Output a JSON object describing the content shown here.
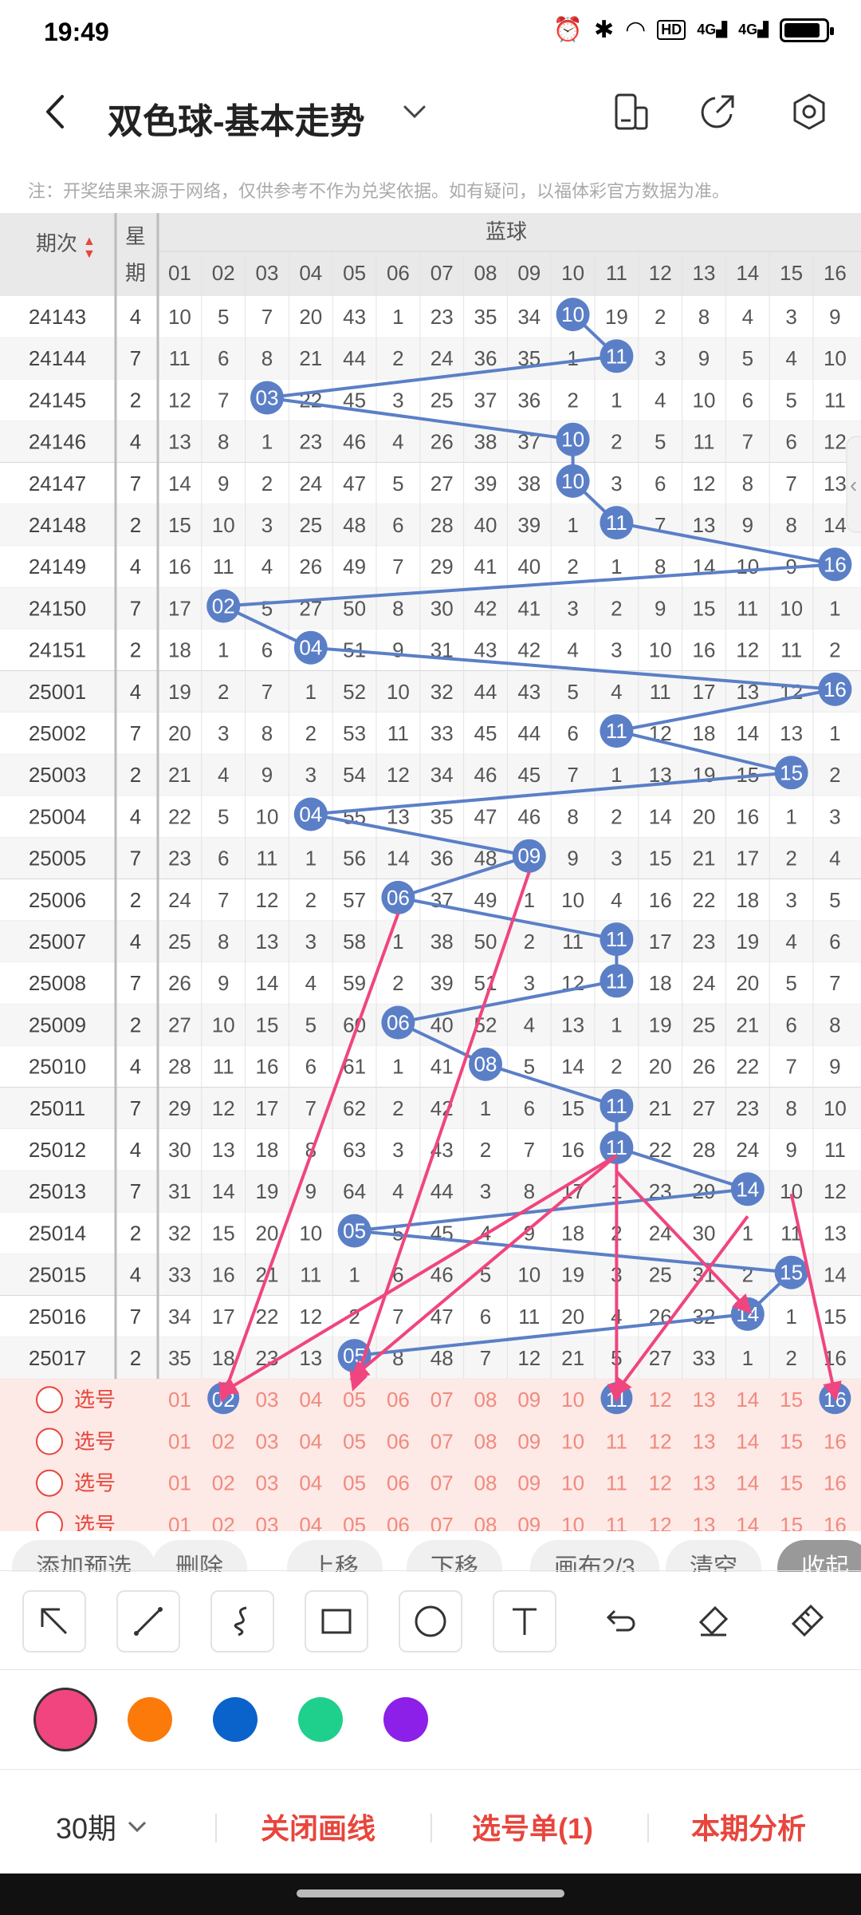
{
  "status": {
    "time": "19:49",
    "hd_label": "HD",
    "net1": "4G",
    "net2": "4G"
  },
  "app_bar": {
    "title": "双色球-基本走势"
  },
  "notice": "注：开奖结果来源于网络，仅供参考不作为兑奖依据。如有疑问，以福体彩官方数据为准。",
  "table": {
    "header_period": "期次",
    "header_weekday_1": "星",
    "header_weekday_2": "期",
    "header_blue": "蓝球",
    "columns": [
      "01",
      "02",
      "03",
      "04",
      "05",
      "06",
      "07",
      "08",
      "09",
      "10",
      "11",
      "12",
      "13",
      "14",
      "15",
      "16"
    ],
    "rows": [
      {
        "period": "24143",
        "weekday": "4",
        "blue": "10",
        "cells": [
          "10",
          "5",
          "7",
          "20",
          "43",
          "1",
          "23",
          "35",
          "34",
          "10",
          "19",
          "2",
          "8",
          "4",
          "3",
          "9"
        ]
      },
      {
        "period": "24144",
        "weekday": "7",
        "blue": "11",
        "cells": [
          "11",
          "6",
          "8",
          "21",
          "44",
          "2",
          "24",
          "36",
          "35",
          "1",
          "11",
          "3",
          "9",
          "5",
          "4",
          "10"
        ]
      },
      {
        "period": "24145",
        "weekday": "2",
        "blue": "03",
        "cells": [
          "12",
          "7",
          "03",
          "22",
          "45",
          "3",
          "25",
          "37",
          "36",
          "2",
          "1",
          "4",
          "10",
          "6",
          "5",
          "11"
        ]
      },
      {
        "period": "24146",
        "weekday": "4",
        "blue": "10",
        "cells": [
          "13",
          "8",
          "1",
          "23",
          "46",
          "4",
          "26",
          "38",
          "37",
          "10",
          "2",
          "5",
          "11",
          "7",
          "6",
          "12"
        ]
      },
      {
        "period": "24147",
        "weekday": "7",
        "blue": "10",
        "cells": [
          "14",
          "9",
          "2",
          "24",
          "47",
          "5",
          "27",
          "39",
          "38",
          "10",
          "3",
          "6",
          "12",
          "8",
          "7",
          "13"
        ]
      },
      {
        "period": "24148",
        "weekday": "2",
        "blue": "11",
        "cells": [
          "15",
          "10",
          "3",
          "25",
          "48",
          "6",
          "28",
          "40",
          "39",
          "1",
          "11",
          "7",
          "13",
          "9",
          "8",
          "14"
        ]
      },
      {
        "period": "24149",
        "weekday": "4",
        "blue": "16",
        "cells": [
          "16",
          "11",
          "4",
          "26",
          "49",
          "7",
          "29",
          "41",
          "40",
          "2",
          "1",
          "8",
          "14",
          "10",
          "9",
          "16"
        ]
      },
      {
        "period": "24150",
        "weekday": "7",
        "blue": "02",
        "cells": [
          "17",
          "02",
          "5",
          "27",
          "50",
          "8",
          "30",
          "42",
          "41",
          "3",
          "2",
          "9",
          "15",
          "11",
          "10",
          "1"
        ]
      },
      {
        "period": "24151",
        "weekday": "2",
        "blue": "04",
        "cells": [
          "18",
          "1",
          "6",
          "04",
          "51",
          "9",
          "31",
          "43",
          "42",
          "4",
          "3",
          "10",
          "16",
          "12",
          "11",
          "2"
        ]
      },
      {
        "period": "25001",
        "weekday": "4",
        "blue": "16",
        "cells": [
          "19",
          "2",
          "7",
          "1",
          "52",
          "10",
          "32",
          "44",
          "43",
          "5",
          "4",
          "11",
          "17",
          "13",
          "12",
          "16"
        ]
      },
      {
        "period": "25002",
        "weekday": "7",
        "blue": "11",
        "cells": [
          "20",
          "3",
          "8",
          "2",
          "53",
          "11",
          "33",
          "45",
          "44",
          "6",
          "11",
          "12",
          "18",
          "14",
          "13",
          "1"
        ]
      },
      {
        "period": "25003",
        "weekday": "2",
        "blue": "15",
        "cells": [
          "21",
          "4",
          "9",
          "3",
          "54",
          "12",
          "34",
          "46",
          "45",
          "7",
          "1",
          "13",
          "19",
          "15",
          "15",
          "2"
        ]
      },
      {
        "period": "25004",
        "weekday": "4",
        "blue": "04",
        "cells": [
          "22",
          "5",
          "10",
          "04",
          "55",
          "13",
          "35",
          "47",
          "46",
          "8",
          "2",
          "14",
          "20",
          "16",
          "1",
          "3"
        ]
      },
      {
        "period": "25005",
        "weekday": "7",
        "blue": "09",
        "cells": [
          "23",
          "6",
          "11",
          "1",
          "56",
          "14",
          "36",
          "48",
          "09",
          "9",
          "3",
          "15",
          "21",
          "17",
          "2",
          "4"
        ]
      },
      {
        "period": "25006",
        "weekday": "2",
        "blue": "06",
        "cells": [
          "24",
          "7",
          "12",
          "2",
          "57",
          "06",
          "37",
          "49",
          "1",
          "10",
          "4",
          "16",
          "22",
          "18",
          "3",
          "5"
        ]
      },
      {
        "period": "25007",
        "weekday": "4",
        "blue": "11",
        "cells": [
          "25",
          "8",
          "13",
          "3",
          "58",
          "1",
          "38",
          "50",
          "2",
          "11",
          "11",
          "17",
          "23",
          "19",
          "4",
          "6"
        ]
      },
      {
        "period": "25008",
        "weekday": "7",
        "blue": "11",
        "cells": [
          "26",
          "9",
          "14",
          "4",
          "59",
          "2",
          "39",
          "51",
          "3",
          "12",
          "11",
          "18",
          "24",
          "20",
          "5",
          "7"
        ]
      },
      {
        "period": "25009",
        "weekday": "2",
        "blue": "06",
        "cells": [
          "27",
          "10",
          "15",
          "5",
          "60",
          "06",
          "40",
          "52",
          "4",
          "13",
          "1",
          "19",
          "25",
          "21",
          "6",
          "8"
        ]
      },
      {
        "period": "25010",
        "weekday": "4",
        "blue": "08",
        "cells": [
          "28",
          "11",
          "16",
          "6",
          "61",
          "1",
          "41",
          "08",
          "5",
          "14",
          "2",
          "20",
          "26",
          "22",
          "7",
          "9"
        ]
      },
      {
        "period": "25011",
        "weekday": "7",
        "blue": "11",
        "cells": [
          "29",
          "12",
          "17",
          "7",
          "62",
          "2",
          "42",
          "1",
          "6",
          "15",
          "11",
          "21",
          "27",
          "23",
          "8",
          "10"
        ]
      },
      {
        "period": "25012",
        "weekday": "4",
        "blue": "11",
        "cells": [
          "30",
          "13",
          "18",
          "8",
          "63",
          "3",
          "43",
          "2",
          "7",
          "16",
          "11",
          "22",
          "28",
          "24",
          "9",
          "11"
        ]
      },
      {
        "period": "25013",
        "weekday": "7",
        "blue": "14",
        "cells": [
          "31",
          "14",
          "19",
          "9",
          "64",
          "4",
          "44",
          "3",
          "8",
          "17",
          "1",
          "23",
          "29",
          "14",
          "10",
          "12"
        ]
      },
      {
        "period": "25014",
        "weekday": "2",
        "blue": "05",
        "cells": [
          "32",
          "15",
          "20",
          "10",
          "05",
          "5",
          "45",
          "4",
          "9",
          "18",
          "2",
          "24",
          "30",
          "1",
          "11",
          "13"
        ]
      },
      {
        "period": "25015",
        "weekday": "4",
        "blue": "15",
        "cells": [
          "33",
          "16",
          "21",
          "11",
          "1",
          "6",
          "46",
          "5",
          "10",
          "19",
          "3",
          "25",
          "31",
          "2",
          "15",
          "14"
        ]
      },
      {
        "period": "25016",
        "weekday": "7",
        "blue": "14",
        "cells": [
          "34",
          "17",
          "22",
          "12",
          "2",
          "7",
          "47",
          "6",
          "11",
          "20",
          "4",
          "26",
          "32",
          "14",
          "1",
          "15"
        ]
      },
      {
        "period": "25017",
        "weekday": "2",
        "blue": "05",
        "cells": [
          "35",
          "18",
          "23",
          "13",
          "05",
          "8",
          "48",
          "7",
          "12",
          "21",
          "5",
          "27",
          "33",
          "1",
          "2",
          "16"
        ]
      }
    ],
    "pick_rows": [
      {
        "label": "选号",
        "selected": [
          "02",
          "11",
          "16"
        ]
      },
      {
        "label": "选号",
        "selected": []
      },
      {
        "label": "选号",
        "selected": []
      },
      {
        "label": "选号",
        "selected": []
      }
    ]
  },
  "chips": [
    "添加预选",
    "删除",
    "上移",
    "下移",
    "画布2/3",
    "清空",
    "收起"
  ],
  "draw_tools": [
    "select-arrow",
    "line",
    "curve",
    "rectangle",
    "circle",
    "text",
    "undo",
    "eraser",
    "clear"
  ],
  "colors": [
    "#f0457e",
    "#fb7a0a",
    "#0a62cb",
    "#1fcf8c",
    "#8c1fe8"
  ],
  "bottom": {
    "period_label": "30期",
    "close_lines": "关闭画线",
    "picks": "选号单(1)",
    "analysis": "本期分析"
  },
  "theme": {
    "blue_ball": "#5b7fc7",
    "pink_arrow": "#f0457e",
    "accent_red": "#e8453c"
  }
}
